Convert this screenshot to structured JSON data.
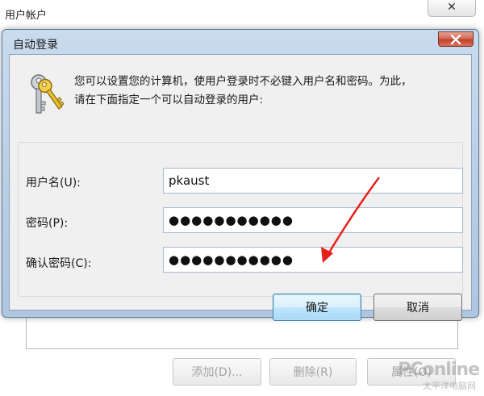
{
  "background_window": {
    "title": "用户帐户",
    "buttons": {
      "add": "添加(D)...",
      "delete": "删除(R)",
      "properties": "属性(O)"
    },
    "watermark": "PConline",
    "watermark_sub": "太平洋电脑网"
  },
  "dialog": {
    "title": "自动登录",
    "description_line1": "您可以设置您的计算机，使用户登录时不必键入用户名和密码。为此，",
    "description_line2": "请在下面指定一个可以自动登录的用户:",
    "fields": {
      "username_label": "用户名(U):",
      "username_value": "pkaust",
      "password_label": "密码(P):",
      "password_value": "●●●●●●●●●●●",
      "confirm_label": "确认密码(C):",
      "confirm_value": "●●●●●●●●●●●"
    },
    "ok_label": "确定",
    "cancel_label": "取消"
  },
  "icons": {
    "keys": "keys-icon",
    "close": "close-icon"
  },
  "colors": {
    "arrow": "#e8201c",
    "close_button": "#c84a33",
    "primary_button_border": "#3c7fb1"
  }
}
